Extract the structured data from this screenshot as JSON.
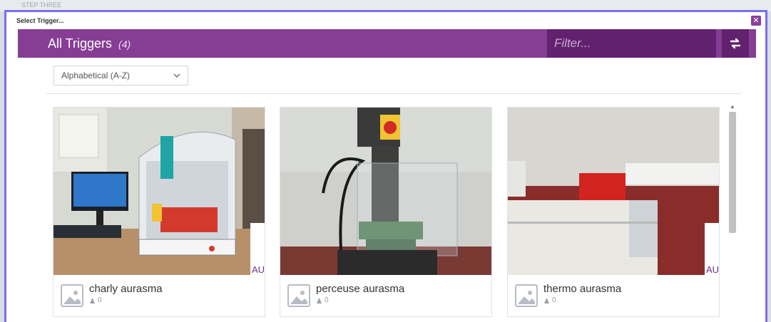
{
  "background": {
    "strip_text": "STEP THREE"
  },
  "dialog": {
    "title": "Select Trigger...",
    "close_glyph": "✕"
  },
  "header": {
    "title": "All Triggers",
    "count": "(4)",
    "filter_placeholder": "Filter...",
    "refresh_icon": "exchange-icon",
    "colors": {
      "bar": "#853e93",
      "dark": "#62216f"
    }
  },
  "sort": {
    "selected": "Alphabetical (A-Z)"
  },
  "triggers": [
    {
      "name": "charly aurasma",
      "views": "0",
      "image_watermark": "AU"
    },
    {
      "name": "perceuse aurasma",
      "views": "0",
      "image_watermark": ""
    },
    {
      "name": "thermo aurasma",
      "views": "0",
      "image_watermark": "AU"
    }
  ]
}
